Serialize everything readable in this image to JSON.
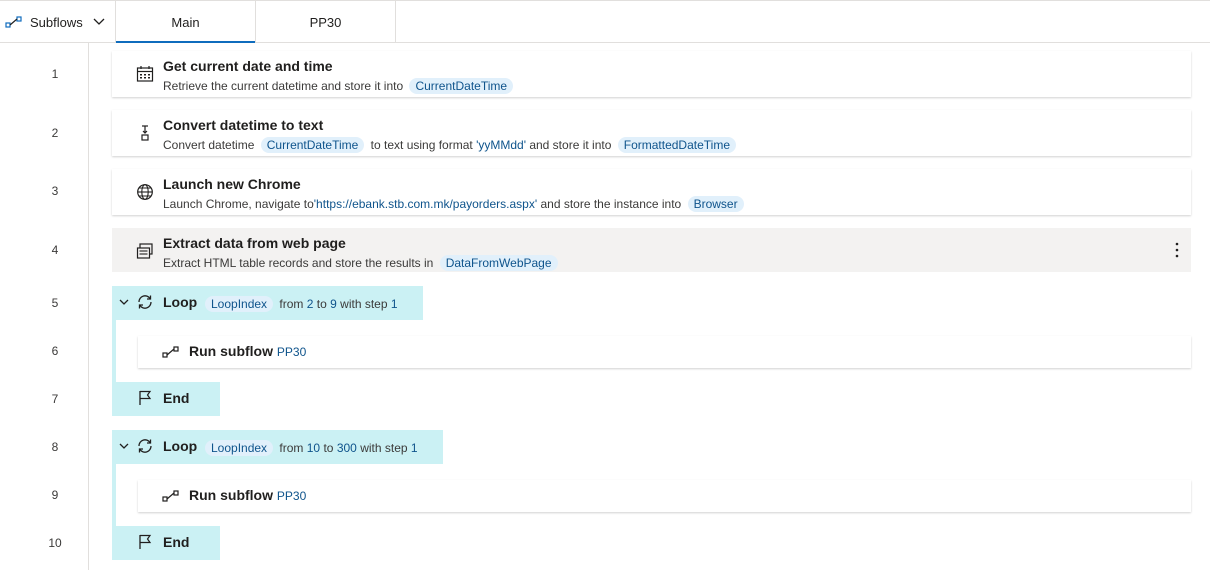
{
  "header": {
    "subflows_label": "Subflows",
    "tabs": [
      {
        "label": "Main",
        "active": true
      },
      {
        "label": "PP30",
        "active": false
      }
    ]
  },
  "line_numbers": [
    "1",
    "2",
    "3",
    "4",
    "5",
    "6",
    "7",
    "8",
    "9",
    "10"
  ],
  "actions": {
    "a1": {
      "title": "Get current date and time",
      "desc_pre": "Retrieve the current datetime and store it into",
      "var": "CurrentDateTime"
    },
    "a2": {
      "title": "Convert datetime to text",
      "desc_pre": "Convert datetime",
      "var_in": "CurrentDateTime",
      "desc_mid": "to text using format",
      "format": "'yyMMdd'",
      "desc_mid2": "and store it into",
      "var_out": "FormattedDateTime"
    },
    "a3": {
      "title": "Launch new Chrome",
      "desc_pre": "Launch Chrome, navigate to",
      "url": "'https://ebank.stb.com.mk/payorders.aspx'",
      "desc_mid": "and store the instance into",
      "var": "Browser"
    },
    "a4": {
      "title": "Extract data from web page",
      "desc_pre": "Extract HTML table records and store the results in",
      "var": "DataFromWebPage"
    }
  },
  "loops": [
    {
      "title": "Loop",
      "var": "LoopIndex",
      "from_word": "from",
      "from": "2",
      "to_word": "to",
      "to": "9",
      "step_word": "with step",
      "step": "1",
      "run_title": "Run subflow",
      "run_target": "PP30",
      "end_label": "End"
    },
    {
      "title": "Loop",
      "var": "LoopIndex",
      "from_word": "from",
      "from": "10",
      "to_word": "to",
      "to": "300",
      "step_word": "with step",
      "step": "1",
      "run_title": "Run subflow",
      "run_target": "PP30",
      "end_label": "End"
    }
  ],
  "colors": {
    "accent": "#0f6cbd",
    "variable_bg": "#e1f0fb",
    "loop_bg": "#cbf1f4",
    "selected_bg": "#f3f2f1"
  }
}
